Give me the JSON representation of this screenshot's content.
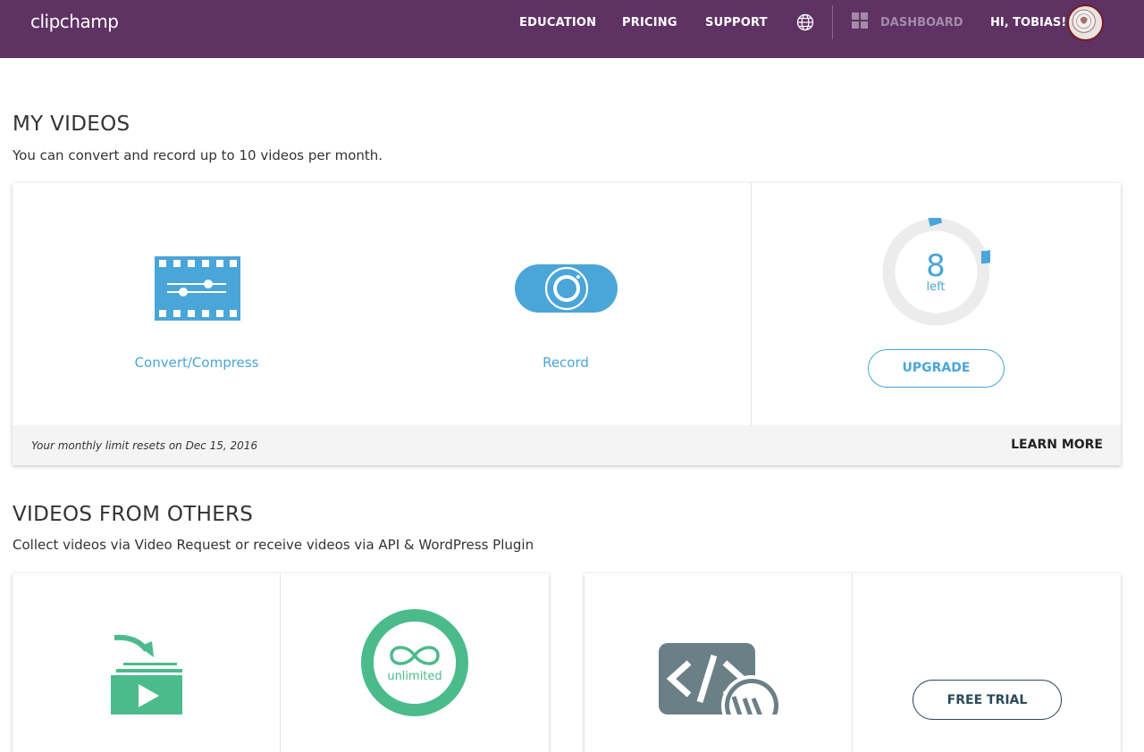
{
  "header": {
    "logo": "clipchamp",
    "nav": {
      "education": "EDUCATION",
      "pricing": "PRICING",
      "support": "SUPPORT",
      "dashboard": "DASHBOARD",
      "greeting": "HI, TOBIAS!"
    },
    "icons": {
      "language": "globe-icon",
      "dashboard": "grid-icon",
      "user": "avatar"
    }
  },
  "my_videos": {
    "title": "MY VIDEOS",
    "subtitle": "You can convert and record up to 10 videos per month.",
    "actions": {
      "convert": {
        "label": "Convert/Compress",
        "icon": "film-sliders-icon"
      },
      "record": {
        "label": "Record",
        "icon": "camera-icon"
      }
    },
    "quota": {
      "remaining": "8",
      "remaining_label": "left",
      "used_fraction": 0.2,
      "upgrade_label": "UPGRADE"
    },
    "footer": {
      "note": "Your monthly limit resets on Dec 15, 2016",
      "learn_more": "LEARN MORE"
    }
  },
  "videos_from_others": {
    "title": "VIDEOS FROM OTHERS",
    "subtitle": "Collect videos via Video Request or receive videos via API & WordPress Plugin",
    "request": {
      "icon": "video-request-icon",
      "unlimited_label": "unlimited"
    },
    "api": {
      "icon": "code-wordpress-icon",
      "free_trial_label": "FREE TRIAL"
    }
  },
  "colors": {
    "header_bg": "#5f3264",
    "accent_blue": "#4aa5d9",
    "accent_green": "#4bbb8b",
    "api_gray": "#6b7f86",
    "ring_track": "#ececec"
  }
}
